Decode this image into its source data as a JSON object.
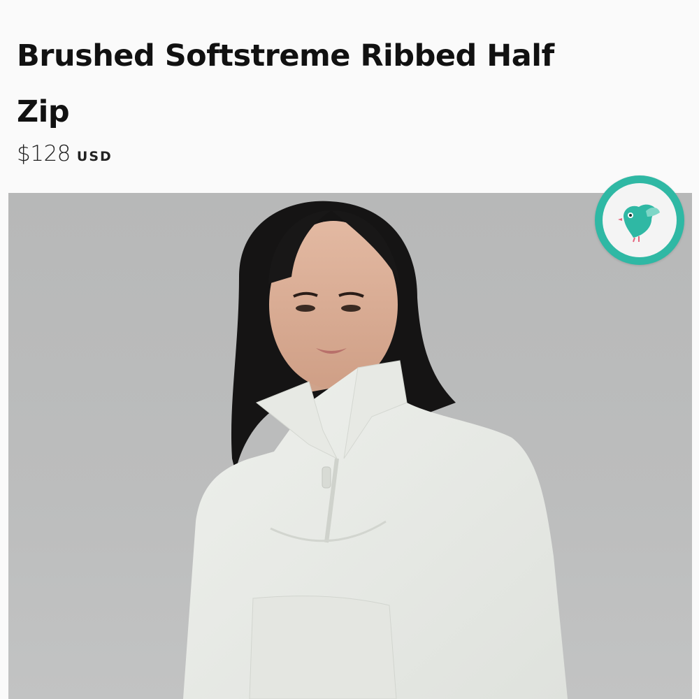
{
  "product": {
    "title": "Brushed Softstreme Ribbed Half Zip",
    "price": "$128",
    "currency": "USD"
  },
  "image": {
    "subject": "model-wearing-light-half-zip"
  },
  "badge": {
    "icon": "teal-bird-icon",
    "accent_color": "#2fb8a4"
  }
}
